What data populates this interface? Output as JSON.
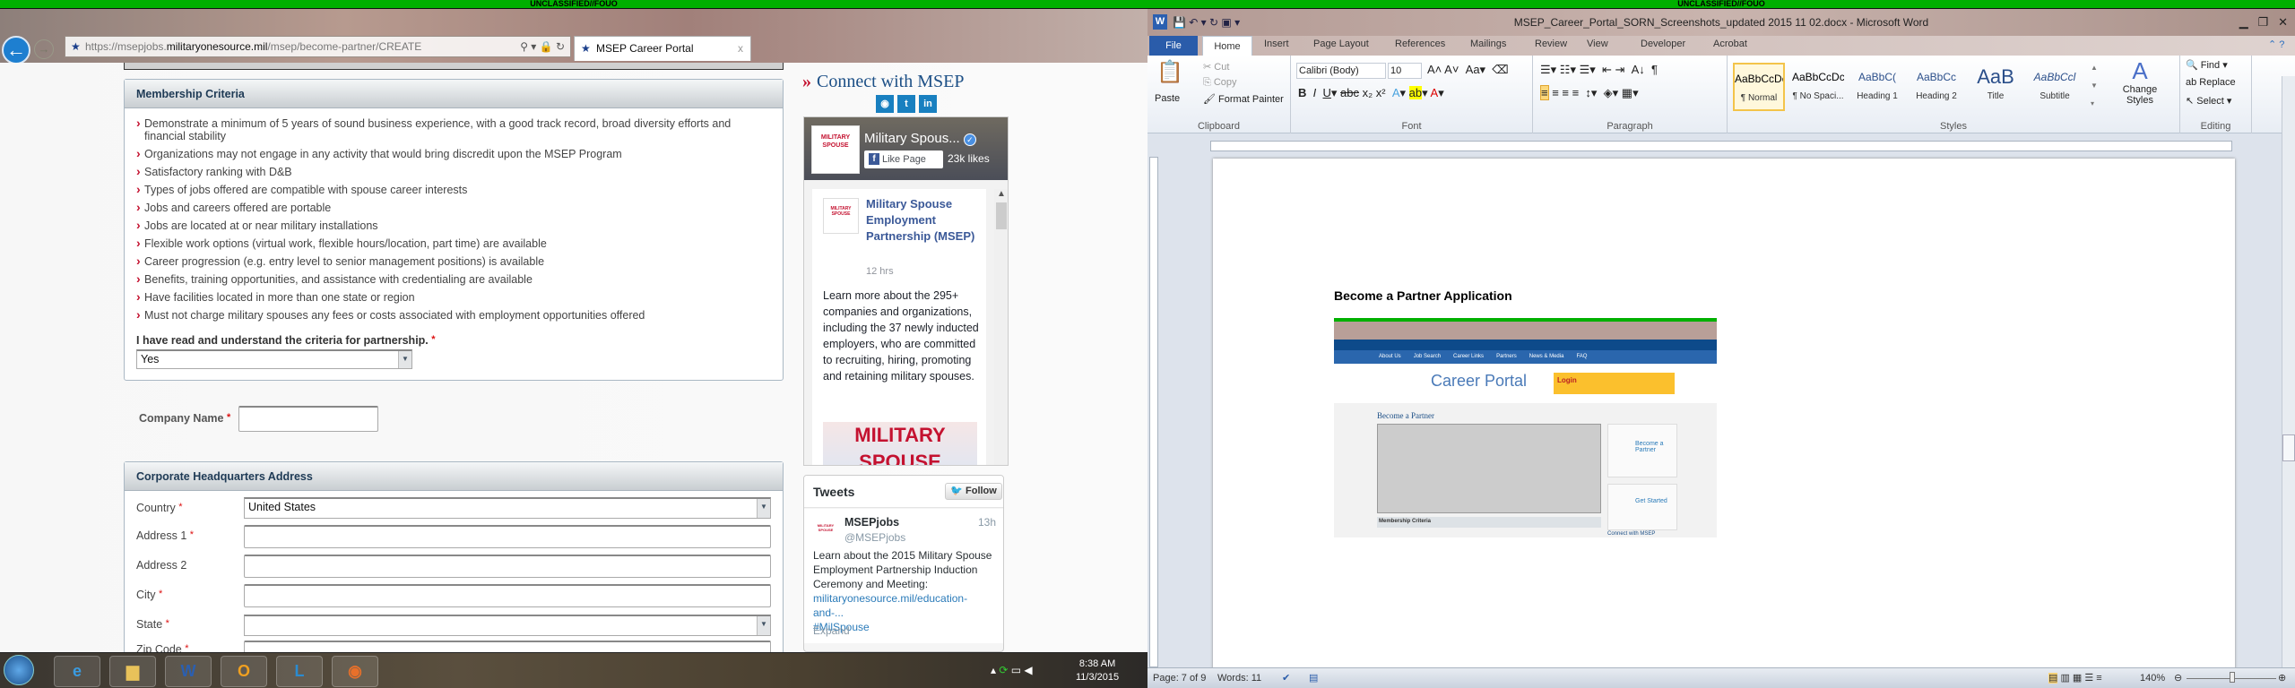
{
  "classification_banner": "UNCLASSIFIED//FOUO",
  "browser": {
    "url_prefix": "https://msepjobs.",
    "url_domain": "militaryonesource.mil",
    "url_path": "/msep/become-partner/CREATE",
    "tab_title": "MSEP Career Portal",
    "tab_close": "x"
  },
  "form": {
    "membership_header": "Membership Criteria",
    "criteria": [
      "Demonstrate a minimum of 5 years of sound business experience, with a good track record, broad diversity efforts and financial stability",
      "Organizations may not engage in any activity that would bring discredit upon the MSEP Program",
      "Satisfactory ranking with D&B",
      "Types of jobs offered are compatible with spouse career interests",
      "Jobs and careers offered are portable",
      "Jobs are located at or near military installations",
      "Flexible work options (virtual work, flexible hours/location, part time) are available",
      "Career progression (e.g. entry level to senior management positions) is available",
      "Benefits, training opportunities, and assistance with credentialing are available",
      "Have facilities located in more than one state or region",
      "Must not charge military spouses any fees or costs associated with employment opportunities offered"
    ],
    "ack_label": "I have read and understand the criteria for partnership.",
    "ack_value": "Yes",
    "required_mark": "*",
    "company_name_label": "Company Name",
    "hq_header": "Corporate Headquarters Address",
    "country_label": "Country",
    "country_value": "United States",
    "address1_label": "Address 1",
    "address2_label": "Address 2",
    "city_label": "City",
    "state_label": "State",
    "zip_label": "Zip Code"
  },
  "sidebar": {
    "connect_title": "Connect with MSEP",
    "connect_marker": "»",
    "fb": {
      "page_name": "Military Spous...",
      "like_label": "Like Page",
      "likes": "23k likes",
      "logo_text": "MILITARY SPOUSE",
      "post_author": "Military Spouse Employment Partnership (MSEP)",
      "post_time": "12 hrs",
      "post_text": "Learn more about the 295+ companies and organizations, including the 37 newly inducted employers, who are committed to recruiting, hiring, promoting and retaining military spouses.",
      "image_text_1": "MILITARY",
      "image_text_2": "SPOUSE"
    },
    "tweets": {
      "title": "Tweets",
      "follow": "Follow",
      "name": "MSEPjobs",
      "handle": "@MSEPjobs",
      "time": "13h",
      "text": "Learn about the 2015 Military Spouse Employment Partnership Induction Ceremony and Meeting:",
      "link": "militaryonesource.mil/education-and-...",
      "hashtag": "#MilSpouse",
      "expand": "Expand"
    }
  },
  "taskbar": {
    "time": "8:38 AM",
    "date": "11/3/2015"
  },
  "word": {
    "title": "MSEP_Career_Portal_SORN_Screenshots_updated 2015 11 02.docx - Microsoft Word",
    "tabs": [
      "File",
      "Home",
      "Insert",
      "Page Layout",
      "References",
      "Mailings",
      "Review",
      "View",
      "Developer",
      "Acrobat"
    ],
    "clipboard": {
      "paste": "Paste",
      "cut": "Cut",
      "copy": "Copy",
      "format_painter": "Format Painter",
      "label": "Clipboard"
    },
    "font": {
      "name": "Calibri (Body)",
      "size": "10",
      "label": "Font"
    },
    "paragraph_label": "Paragraph",
    "styles": [
      {
        "preview": "AaBbCcDc",
        "name": "¶ Normal"
      },
      {
        "preview": "AaBbCcDc",
        "name": "¶ No Spaci..."
      },
      {
        "preview": "AaBbC(",
        "name": "Heading 1"
      },
      {
        "preview": "AaBbCc",
        "name": "Heading 2"
      },
      {
        "preview": "AaB",
        "name": "Title"
      },
      {
        "preview": "AaBbCcl",
        "name": "Subtitle"
      }
    ],
    "styles_label": "Styles",
    "change_styles": "Change Styles",
    "editing": {
      "find": "Find",
      "replace": "Replace",
      "select": "Select",
      "label": "Editing"
    },
    "doc_heading": "Become a Partner Application",
    "embedded": {
      "nav": [
        "About Us",
        "Job Search",
        "Career Links",
        "Partners",
        "News & Media",
        "FAQ"
      ],
      "portal": "Career Portal",
      "login": "Login",
      "page_title": "Become a Partner",
      "side1": "Become a Partner",
      "side2": "Get Started",
      "connect": "Connect with MSEP",
      "criteria_header": "Membership Criteria"
    },
    "status": {
      "page": "Page: 7 of 9",
      "words": "Words: 11",
      "zoom": "140%"
    }
  }
}
